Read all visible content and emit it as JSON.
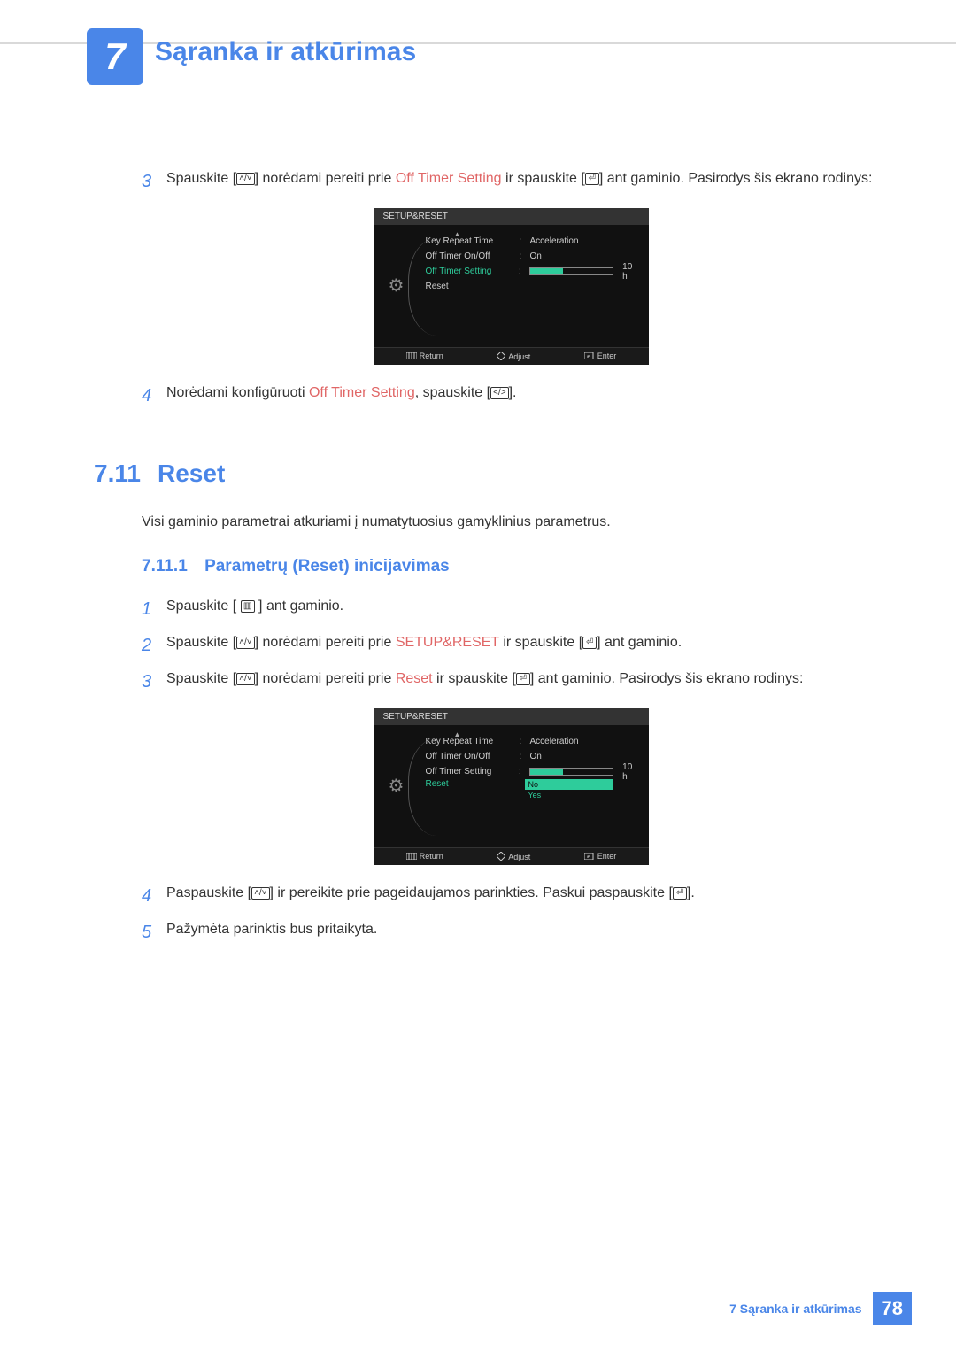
{
  "chapter": {
    "number": "7",
    "title": "Sąranka ir atkūrimas"
  },
  "stepsA": {
    "s3": {
      "num": "3",
      "t1": "Spauskite [",
      "t2": "] norėdami pereiti prie ",
      "hl": "Off Timer Setting",
      "t3": " ir spauskite [",
      "t4": "] ant gaminio. Pasirodys šis ekrano rodinys:"
    },
    "s4": {
      "num": "4",
      "t1": "Norėdami konfigūruoti ",
      "hl": "Off Timer Setting",
      "t2": ", spauskite [",
      "t3": "]."
    }
  },
  "osd": {
    "header": "SETUP&RESET",
    "rows": {
      "keyRepeat": {
        "label": "Key Repeat Time",
        "value": "Acceleration"
      },
      "offTimerOnOff": {
        "label": "Off Timer On/Off",
        "value": "On"
      },
      "offTimerSetting": {
        "label": "Off Timer Setting",
        "sliderValue": "10 h",
        "fillPercent": "40%"
      },
      "reset": {
        "label": "Reset"
      }
    },
    "dropdown": {
      "no": "No",
      "yes": "Yes"
    },
    "footer": {
      "return": "Return",
      "adjust": "Adjust",
      "enter": "Enter"
    }
  },
  "section": {
    "num": "7.11",
    "title": "Reset",
    "desc": "Visi gaminio parametrai atkuriami į numatytuosius gamyklinius parametrus."
  },
  "subsection": {
    "num": "7.11.1",
    "title": "Parametrų (Reset) inicijavimas"
  },
  "stepsB": {
    "s1": {
      "num": "1",
      "t1": "Spauskite [ ",
      "t2": " ] ant gaminio."
    },
    "s2": {
      "num": "2",
      "t1": "Spauskite [",
      "t2": "] norėdami pereiti prie ",
      "hl": "SETUP&RESET",
      "t3": " ir spauskite [",
      "t4": "] ant gaminio."
    },
    "s3": {
      "num": "3",
      "t1": "Spauskite [",
      "t2": "] norėdami pereiti prie ",
      "hl": "Reset",
      "t3": " ir spauskite [",
      "t4": "] ant gaminio. Pasirodys šis ekrano rodinys:"
    },
    "s4": {
      "num": "4",
      "t1": "Paspauskite [",
      "t2": "] ir pereikite prie pageidaujamos parinkties. Paskui paspauskite [",
      "t3": "]."
    },
    "s5": {
      "num": "5",
      "t1": "Pažymėta parinktis bus pritaikyta."
    }
  },
  "footer": {
    "text": "7 Sąranka ir atkūrimas",
    "page": "78"
  }
}
